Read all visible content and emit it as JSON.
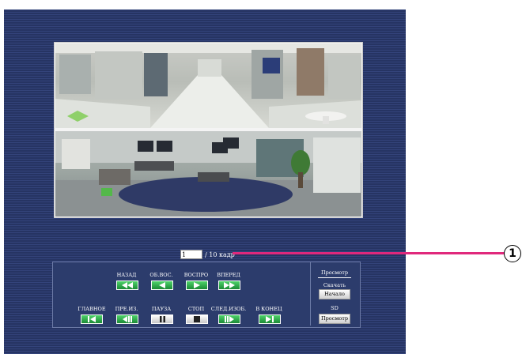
{
  "frame": {
    "value": "1",
    "suffix": "/ 10 кадр"
  },
  "callout": {
    "number": "1"
  },
  "controls": {
    "row1": [
      {
        "label": "НАЗАД",
        "icon": "rewind-icon"
      },
      {
        "label": "ОБ.ВОС.",
        "icon": "reverse-play-icon"
      },
      {
        "label": "ВОСПРО",
        "icon": "play-icon"
      },
      {
        "label": "ВПЕРЕД",
        "icon": "fast-forward-icon"
      }
    ],
    "row2": [
      {
        "label": "ГЛАВНОЕ",
        "icon": "skip-to-start-icon"
      },
      {
        "label": "ПРЕ.ИЗ.",
        "icon": "previous-frame-icon"
      },
      {
        "label": "ПАУЗА",
        "icon": "pause-icon"
      },
      {
        "label": "СТОП",
        "icon": "stop-icon"
      },
      {
        "label": "СЛЕД.ИЗОБ.",
        "icon": "next-frame-icon"
      },
      {
        "label": "В КОНЕЦ",
        "icon": "skip-to-end-icon"
      }
    ],
    "side": {
      "title": "Просмотр",
      "download_label": "Скачать",
      "download_button": "Начало",
      "sd_label": "SD",
      "sd_button": "Просмотр"
    }
  },
  "colors": {
    "accent_green": "#2fb44e",
    "callout_pink": "#e0287c",
    "panel_navy": "#2a3a6a"
  }
}
